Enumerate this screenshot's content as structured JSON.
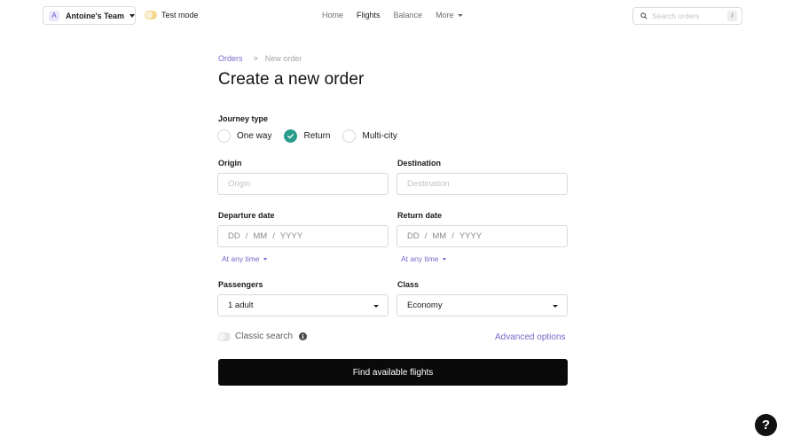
{
  "header": {
    "team_initial": "A",
    "team_name": "Antoine's Team",
    "test_mode_label": "Test mode",
    "nav": [
      {
        "label": "Home",
        "active": false
      },
      {
        "label": "Flights",
        "active": true
      },
      {
        "label": "Balance",
        "active": false
      },
      {
        "label": "More",
        "active": false
      }
    ],
    "search_placeholder": "Search orders",
    "search_shortcut": "/"
  },
  "breadcrumb": {
    "root": "Orders",
    "separator": ">",
    "current": "New order"
  },
  "page_title": "Create a new order",
  "journey": {
    "label": "Journey type",
    "options": [
      {
        "label": "One way",
        "checked": false
      },
      {
        "label": "Return",
        "checked": true
      },
      {
        "label": "Multi-city",
        "checked": false
      }
    ]
  },
  "origin": {
    "label": "Origin",
    "placeholder": "Origin"
  },
  "destination": {
    "label": "Destination",
    "placeholder": "Destination"
  },
  "departure": {
    "label": "Departure date",
    "dd": "DD",
    "mm": "MM",
    "yyyy": "YYYY",
    "time": "At any time"
  },
  "return_date": {
    "label": "Return date",
    "dd": "DD",
    "mm": "MM",
    "yyyy": "YYYY",
    "time": "At any time"
  },
  "passengers": {
    "label": "Passengers",
    "value": "1 adult"
  },
  "cabin_class": {
    "label": "Class",
    "value": "Economy"
  },
  "classic_search": {
    "label": "Classic search",
    "info_icon": "i"
  },
  "advanced_options": "Advanced options",
  "submit": "Find available flights",
  "help_label": "?",
  "colors": {
    "accent_purple": "#7b65c8",
    "check_teal": "#2a9c8a",
    "cta_black": "#0a0a0a"
  }
}
